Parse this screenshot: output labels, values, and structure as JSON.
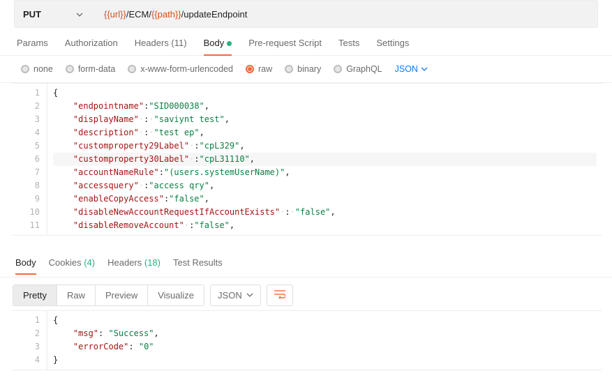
{
  "request": {
    "method": "PUT",
    "url_parts": [
      {
        "type": "var",
        "text": "{{url}}"
      },
      {
        "type": "plain",
        "text": "/ECM/"
      },
      {
        "type": "var",
        "text": "{{path}}"
      },
      {
        "type": "plain",
        "text": "/updateEndpoint"
      }
    ]
  },
  "reqTabs": [
    {
      "label": "Params"
    },
    {
      "label": "Authorization"
    },
    {
      "label": "Headers (11)"
    },
    {
      "label": "Body",
      "active": true,
      "hasDot": true
    },
    {
      "label": "Pre-request Script"
    },
    {
      "label": "Tests"
    },
    {
      "label": "Settings"
    }
  ],
  "bodyTypes": [
    {
      "label": "none"
    },
    {
      "label": "form-data"
    },
    {
      "label": "x-www-form-urlencoded"
    },
    {
      "label": "raw",
      "selected": true
    },
    {
      "label": "binary"
    },
    {
      "label": "GraphQL"
    }
  ],
  "rawLang": "JSON",
  "requestBody": [
    [
      {
        "t": "brace",
        "v": "{"
      }
    ],
    [
      {
        "t": "indent"
      },
      {
        "t": "key",
        "v": "\"endpointname\""
      },
      {
        "t": "punc",
        "v": ":"
      },
      {
        "t": "str",
        "v": "\"SID000038\""
      },
      {
        "t": "punc",
        "v": ","
      }
    ],
    [
      {
        "t": "indent"
      },
      {
        "t": "key",
        "v": "\"displayName\""
      },
      {
        "t": "ws"
      },
      {
        "t": "punc",
        "v": ":"
      },
      {
        "t": "ws"
      },
      {
        "t": "str",
        "v": "\"saviynt test\""
      },
      {
        "t": "punc",
        "v": ","
      }
    ],
    [
      {
        "t": "indent"
      },
      {
        "t": "key",
        "v": "\"description\""
      },
      {
        "t": "ws"
      },
      {
        "t": "punc",
        "v": ":"
      },
      {
        "t": "ws"
      },
      {
        "t": "str",
        "v": "\"test ep\""
      },
      {
        "t": "punc",
        "v": ","
      }
    ],
    [
      {
        "t": "indent"
      },
      {
        "t": "key",
        "v": "\"customproperty29Label\""
      },
      {
        "t": "ws"
      },
      {
        "t": "punc",
        "v": ":"
      },
      {
        "t": "str",
        "v": "\"cpL329\""
      },
      {
        "t": "punc",
        "v": ","
      }
    ],
    [
      {
        "t": "indent"
      },
      {
        "t": "key",
        "v": "\"customproperty30Label\""
      },
      {
        "t": "ws"
      },
      {
        "t": "punc",
        "v": ":"
      },
      {
        "t": "str",
        "v": "\"cpL31110\""
      },
      {
        "t": "punc",
        "v": ","
      }
    ],
    [
      {
        "t": "indent"
      },
      {
        "t": "key",
        "v": "\"accountNameRule\""
      },
      {
        "t": "punc",
        "v": ":"
      },
      {
        "t": "str",
        "v": "\"(users.systemUserName)\""
      },
      {
        "t": "punc",
        "v": ","
      }
    ],
    [
      {
        "t": "indent"
      },
      {
        "t": "key",
        "v": "\"accessquery\""
      },
      {
        "t": "ws"
      },
      {
        "t": "punc",
        "v": ":"
      },
      {
        "t": "str",
        "v": "\"access qry\""
      },
      {
        "t": "punc",
        "v": ","
      }
    ],
    [
      {
        "t": "indent"
      },
      {
        "t": "key",
        "v": "\"enableCopyAccess\""
      },
      {
        "t": "punc",
        "v": ":"
      },
      {
        "t": "str",
        "v": "\"false\""
      },
      {
        "t": "punc",
        "v": ","
      }
    ],
    [
      {
        "t": "indent"
      },
      {
        "t": "key",
        "v": "\"disableNewAccountRequestIfAccountExists\""
      },
      {
        "t": "ws"
      },
      {
        "t": "punc",
        "v": ":"
      },
      {
        "t": "ws"
      },
      {
        "t": "str",
        "v": "\"false\""
      },
      {
        "t": "punc",
        "v": ","
      }
    ],
    [
      {
        "t": "indent"
      },
      {
        "t": "key",
        "v": "\"disableRemoveAccount\""
      },
      {
        "t": "ws"
      },
      {
        "t": "punc",
        "v": ":"
      },
      {
        "t": "str",
        "v": "\"false\""
      },
      {
        "t": "punc",
        "v": ","
      }
    ]
  ],
  "requestBodyHighlight": 6,
  "respTabs": [
    {
      "label": "Body",
      "active": true
    },
    {
      "label": "Cookies",
      "count": "(4)"
    },
    {
      "label": "Headers",
      "count": "(18)"
    },
    {
      "label": "Test Results"
    }
  ],
  "viewModes": [
    {
      "label": "Pretty",
      "active": true
    },
    {
      "label": "Raw"
    },
    {
      "label": "Preview"
    },
    {
      "label": "Visualize"
    }
  ],
  "respLang": "JSON",
  "responseBody": [
    [
      {
        "t": "brace",
        "v": "{"
      }
    ],
    [
      {
        "t": "indent"
      },
      {
        "t": "key",
        "v": "\"msg\""
      },
      {
        "t": "punc",
        "v": ": "
      },
      {
        "t": "str",
        "v": "\"Success\""
      },
      {
        "t": "punc",
        "v": ","
      }
    ],
    [
      {
        "t": "indent"
      },
      {
        "t": "key",
        "v": "\"errorCode\""
      },
      {
        "t": "punc",
        "v": ": "
      },
      {
        "t": "str",
        "v": "\"0\""
      }
    ],
    [
      {
        "t": "brace",
        "v": "}"
      }
    ]
  ]
}
